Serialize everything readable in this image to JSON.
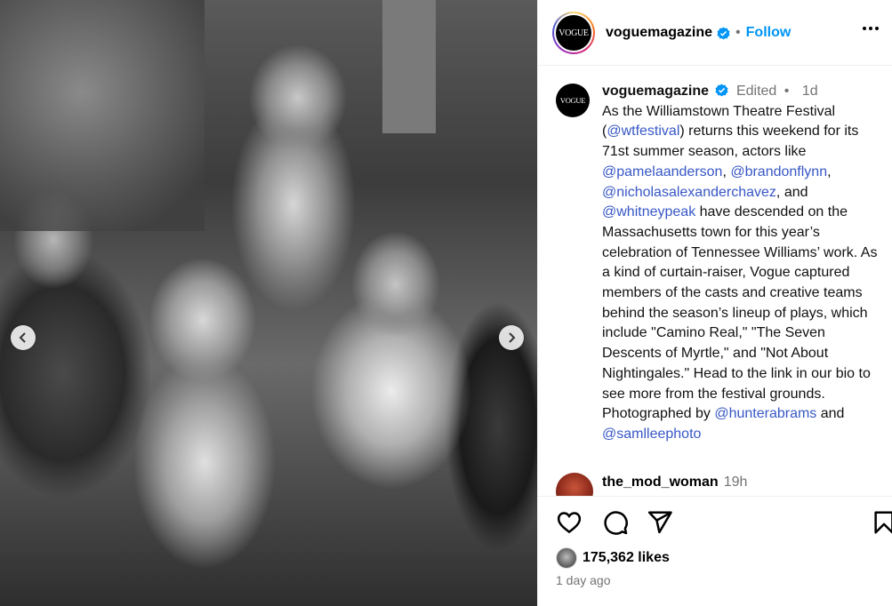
{
  "header": {
    "username": "voguemagazine",
    "separator": "•",
    "follow_label": "Follow",
    "logo_text": "VOGUE"
  },
  "caption": {
    "username": "voguemagazine",
    "edited": "Edited",
    "separator": "•",
    "time": "1d",
    "segments": [
      {
        "text": "As the Williamstown Theatre Festival (",
        "mention": false
      },
      {
        "text": "@wtfestival",
        "mention": true
      },
      {
        "text": ") returns this weekend for its 71st summer season, actors like ",
        "mention": false
      },
      {
        "text": "@pamelaanderson",
        "mention": true
      },
      {
        "text": ", ",
        "mention": false
      },
      {
        "text": "@brandonflynn",
        "mention": true
      },
      {
        "text": ", ",
        "mention": false
      },
      {
        "text": "@nicholasalexanderchavez",
        "mention": true
      },
      {
        "text": ", and ",
        "mention": false
      },
      {
        "text": "@whitneypeak",
        "mention": true
      },
      {
        "text": " have descended on the Massachusetts town for this year’s celebration of Tennessee Williams’ work. As a kind of curtain-raiser, Vogue captured members of the casts and creative teams behind the season’s lineup of plays, which include \"Camino Real,\" \"The Seven Descents of Myrtle,\" and \"Not About Nightingales.\" Head to the link in our bio to see more from the festival grounds. Photographed by ",
        "mention": false
      },
      {
        "text": "@hunterabrams",
        "mention": true
      },
      {
        "text": " and ",
        "mention": false
      },
      {
        "text": "@samlleephoto",
        "mention": true
      }
    ]
  },
  "comment": {
    "username": "the_mod_woman",
    "time": "19h"
  },
  "actions": {
    "likes": "175,362 likes",
    "time_ago": "1 day ago"
  },
  "colors": {
    "accent": "#0095f6",
    "mention": "#3757c6",
    "meta": "#737373"
  }
}
